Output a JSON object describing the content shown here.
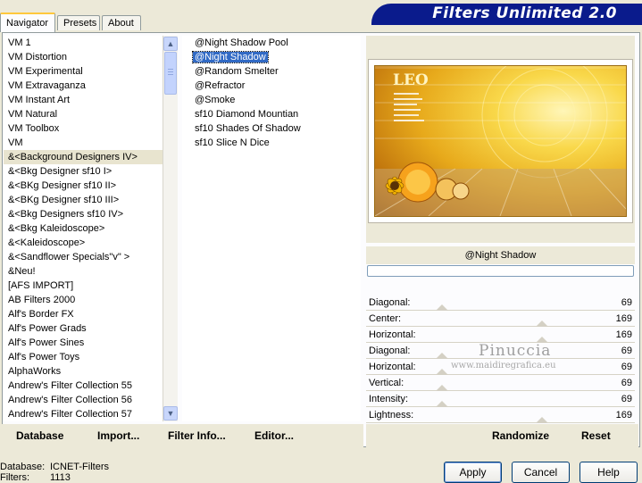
{
  "tabs": [
    {
      "label": "Navigator"
    },
    {
      "label": "Presets"
    },
    {
      "label": "About"
    }
  ],
  "title": "Filters Unlimited 2.0",
  "categories": [
    "VM 1",
    "VM Distortion",
    "VM Experimental",
    "VM Extravaganza",
    "VM Instant Art",
    "VM Natural",
    "VM Toolbox",
    "VM",
    "&<Background Designers IV>",
    "&<Bkg Designer sf10 I>",
    "&<BKg Designer sf10 II>",
    "&<BKg Designer sf10 III>",
    "&<Bkg Designers sf10 IV>",
    "&<Bkg Kaleidoscope>",
    "&<Kaleidoscope>",
    "&<Sandflower Specials\"v\" >",
    "&Neu!",
    "[AFS IMPORT]",
    "AB Filters 2000",
    "Alf's Border FX",
    "Alf's Power Grads",
    "Alf's Power Sines",
    "Alf's Power Toys",
    "AlphaWorks",
    "Andrew's Filter Collection 55",
    "Andrew's Filter Collection 56",
    "Andrew's Filter Collection 57"
  ],
  "selected_category": 8,
  "filters": [
    "@Night Shadow Pool",
    "@Night Shadow",
    "@Random Smelter",
    "@Refractor",
    "@Smoke",
    "sf10 Diamond Mountian",
    "sf10 Shades Of Shadow",
    "sf10 Slice N Dice"
  ],
  "selected_filter": 1,
  "preview": {
    "logo_text": "LEO"
  },
  "current_filter_name": "@Night Shadow",
  "progress": 0,
  "sliders": [
    {
      "label": "Diagonal:",
      "value": "69"
    },
    {
      "label": "Center:",
      "value": "169"
    },
    {
      "label": "Horizontal:",
      "value": "169"
    },
    {
      "label": "Diagonal:",
      "value": "69"
    },
    {
      "label": "Horizontal:",
      "value": "69"
    },
    {
      "label": "Vertical:",
      "value": "69"
    },
    {
      "label": "Intensity:",
      "value": "69"
    },
    {
      "label": "Lightness:",
      "value": "169"
    }
  ],
  "watermark": {
    "line1": "Pinuccia",
    "line2": "www.maidiregrafica.eu"
  },
  "toolbar": {
    "database": "Database",
    "import": "Import...",
    "filter_info": "Filter Info...",
    "editor": "Editor...",
    "randomize": "Randomize",
    "reset": "Reset"
  },
  "status": {
    "database_label": "Database:",
    "database_value": "ICNET-Filters",
    "filters_label": "Filters:",
    "filters_value": "1113"
  },
  "buttons": {
    "apply": "Apply",
    "cancel": "Cancel",
    "help": "Help"
  },
  "colors": {
    "banner": "#0a1b8c",
    "selection": "#316ac5",
    "tab_highlight": "#ffc83c"
  },
  "icons": {
    "scroll_up": "scroll-up-arrow-icon",
    "scroll_down": "scroll-down-arrow-icon"
  }
}
